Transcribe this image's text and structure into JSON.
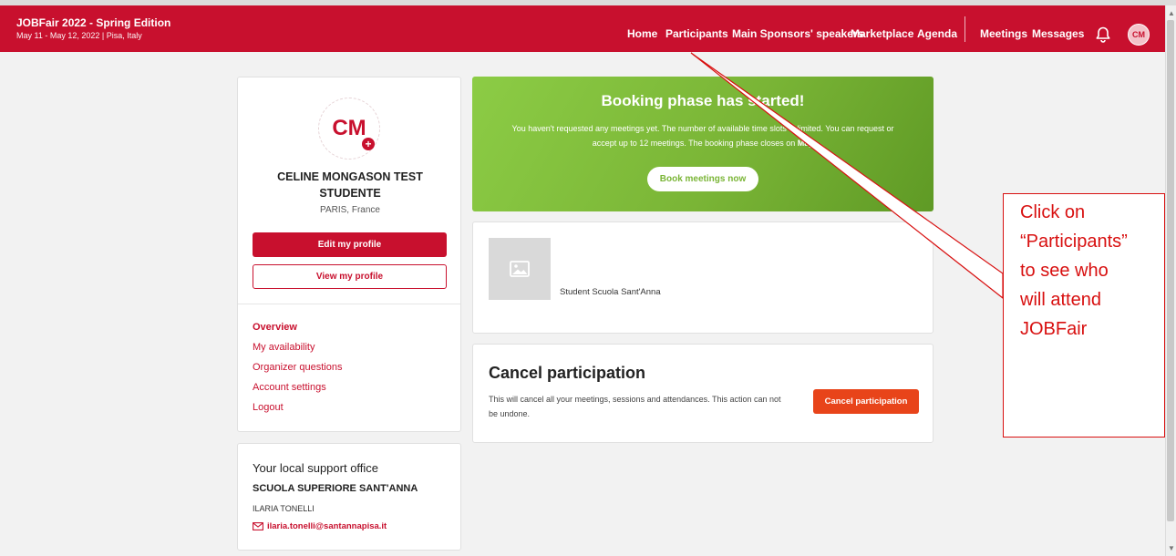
{
  "header": {
    "event_title": "JOBFair 2022 - Spring Edition",
    "event_subtitle": "May 11 - May 12, 2022 | Pisa, Italy",
    "nav": [
      "Home",
      "Participants",
      "Main Sponsors' speakers",
      "Marketplace",
      "Agenda"
    ],
    "nav_right": [
      "Meetings",
      "Messages"
    ],
    "avatar_initials": "CM",
    "bell_icon": "bell-icon",
    "brand_color": "#c8102e"
  },
  "profile": {
    "initials": "CM",
    "name": "CELINE MONGASON TEST STUDENTE",
    "location": "PARIS, France",
    "edit_label": "Edit my profile",
    "view_label": "View my profile",
    "menu": [
      "Overview",
      "My availability",
      "Organizer questions",
      "Account settings",
      "Logout"
    ]
  },
  "support": {
    "title": "Your local support office",
    "org": "SCUOLA SUPERIORE SANT'ANNA",
    "person": "ILARIA TONELLI",
    "email": "ilaria.tonelli@santannapisa.it",
    "email_icon": "mail-icon"
  },
  "booking": {
    "title": "Booking phase has started!",
    "text_1": "You haven't requested any meetings yet. The number of available time slots is limited. You can request or",
    "text_2_a": "accept up to 12 meetings. The booking phase closes on ",
    "text_2_b": "May",
    "button": "Book meetings now",
    "accent": "#7ab536"
  },
  "organization": {
    "label": "Student Scuola Sant'Anna",
    "image_icon": "image-placeholder-icon"
  },
  "cancel": {
    "title": "Cancel participation",
    "text": "This will cancel all your meetings, sessions and attendances. This action can not be undone.",
    "button": "Cancel participation",
    "accent": "#e8441a"
  },
  "callout": {
    "lines": [
      "Click on",
      "“Participants”",
      "to see who",
      "will attend",
      "JOBFair"
    ],
    "color": "#d81010"
  }
}
